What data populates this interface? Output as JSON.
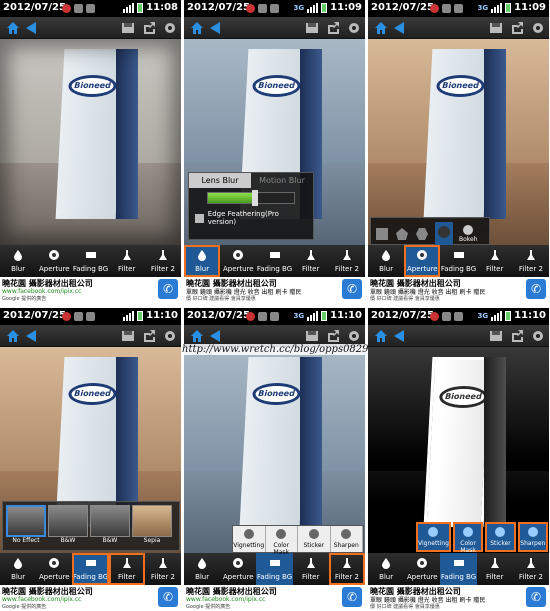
{
  "panels": [
    {
      "date": "2012/07/25",
      "time": "11:08",
      "net": "",
      "tools": [
        "Blur",
        "Aperture",
        "Fading BG",
        "Filter",
        "Filter 2"
      ]
    },
    {
      "date": "2012/07/25",
      "time": "11:09",
      "net": "3G",
      "tools": [
        "Blur",
        "Aperture",
        "Fading BG",
        "Filter",
        "Filter 2"
      ]
    },
    {
      "date": "2012/07/25",
      "time": "11:09",
      "net": "3G",
      "tools": [
        "Blur",
        "Aperture",
        "Fading BG",
        "Filter",
        "Filter 2"
      ]
    },
    {
      "date": "2012/07/25",
      "time": "11:10",
      "net": "",
      "tools": [
        "Blur",
        "Aperture",
        "Fading BG",
        "Filter",
        "Filter 2"
      ]
    },
    {
      "date": "2012/07/25",
      "time": "11:10",
      "net": "3G",
      "tools": [
        "Blur",
        "Aperture",
        "Fading BG",
        "Filter",
        "Filter 2"
      ]
    },
    {
      "date": "2012/07/25",
      "time": "11:10",
      "net": "3G",
      "tools": [
        "Blur",
        "Aperture",
        "Fading BG",
        "Filter",
        "Filter 2"
      ]
    }
  ],
  "photo_logo": "Bioneed",
  "ad": {
    "title": "曉花園 攝影器材出租公司",
    "url": "www.facebook.com/ipix.cc",
    "source": "Google 提供的廣告",
    "tags": "單眼 鏡頭 攝影機 燈光 收音 出租 刷卡 贈民",
    "tags2": "價 好口碑 建議看得 會員享優惠",
    "call_icon": "phone-icon"
  },
  "blur_overlay": {
    "tabs": [
      "Lens Blur",
      "Motion Blur"
    ],
    "checkbox": "Edge Feathering(Pro version)",
    "slider_level": 0.55
  },
  "aperture_overlay": {
    "label": "Bokeh"
  },
  "filter_overlay": {
    "items": [
      "No Effect",
      "B&W",
      "B&W",
      "Sepia"
    ]
  },
  "filter2_overlay": {
    "items": [
      "Vignetting",
      "Color Mask",
      "Sticker",
      "Sharpen"
    ]
  },
  "watermark": "http://www.wretch.cc/blog/opps0829",
  "colors": {
    "accent": "#f07020",
    "selected": "#1f5a96",
    "back": "#2a8fe0"
  }
}
